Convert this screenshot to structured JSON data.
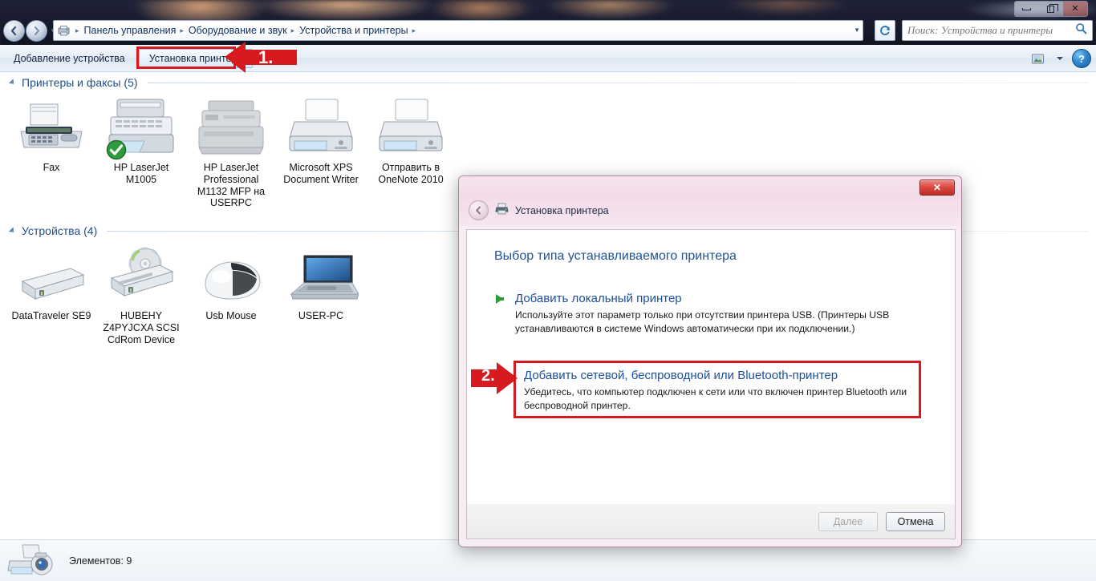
{
  "window": {
    "controls": {
      "minimize": "minimize-button",
      "restore": "restore-button",
      "close": "close-button"
    }
  },
  "address_bar": {
    "breadcrumbs": [
      "Панель управления",
      "Оборудование и звук",
      "Устройства и принтеры"
    ],
    "separator": "▸",
    "refresh_label": "↻"
  },
  "search": {
    "placeholder": "Поиск: Устройства и принтеры",
    "value": ""
  },
  "toolbar": {
    "add_device_label": "Добавление устройства",
    "install_printer_label": "Установка принтера"
  },
  "content": {
    "groups": [
      {
        "title": "Принтеры и факсы (5)",
        "items": [
          {
            "label": "Fax",
            "art": "fax"
          },
          {
            "label": "HP LaserJet M1005",
            "art": "mfp-default"
          },
          {
            "label": "HP LaserJet Professional M1132 MFP на USERPC",
            "art": "mfp-offline"
          },
          {
            "label": "Microsoft XPS Document Writer",
            "art": "printer"
          },
          {
            "label": "Отправить в OneNote 2010",
            "art": "printer"
          }
        ]
      },
      {
        "title": "Устройства (4)",
        "items": [
          {
            "label": "DataTraveler SE9",
            "art": "drive"
          },
          {
            "label": "HUBEHY Z4PYJCXA SCSI CdRom Device",
            "art": "cdrom"
          },
          {
            "label": "Usb Mouse",
            "art": "mouse"
          },
          {
            "label": "USER-PC",
            "art": "laptop"
          }
        ]
      }
    ]
  },
  "status_bar": {
    "text": "Элементов: 9"
  },
  "dialog": {
    "title": "Установка принтера",
    "heading": "Выбор типа устанавливаемого принтера",
    "options": [
      {
        "title": "Добавить локальный принтер",
        "description": "Используйте этот параметр только при отсутствии принтера USB. (Принтеры USB устанавливаются в системе Windows автоматически при их подключении.)"
      },
      {
        "title": "Добавить сетевой, беспроводной или Bluetooth-принтер",
        "description": "Убедитесь, что компьютер подключен к сети или что включен принтер Bluetooth или беспроводной принтер."
      }
    ],
    "buttons": {
      "next": "Далее",
      "cancel": "Отмена"
    },
    "close_glyph": "✕"
  },
  "annotations": [
    {
      "number": "1.",
      "target": "install-printer-button"
    },
    {
      "number": "2.",
      "target": "network-printer-option"
    }
  ],
  "colors": {
    "annotation_red": "#d71920",
    "link_blue": "#1c4f9c",
    "heading_blue": "#205493",
    "group_blue": "#1f4e87",
    "default_badge_green": "#2f9c3c"
  }
}
